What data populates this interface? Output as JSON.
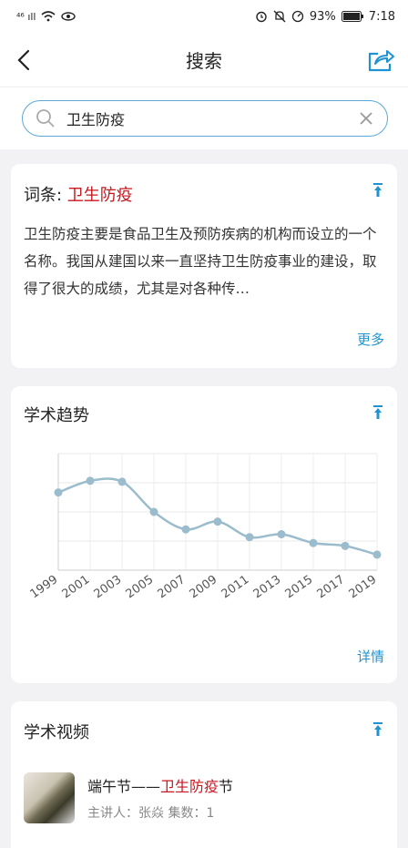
{
  "status": {
    "network": "⁴⁶ ıll",
    "battery": "93%",
    "time": "7:18"
  },
  "header": {
    "title": "搜索"
  },
  "search": {
    "query": "卫生防疫"
  },
  "entry": {
    "label": "词条: ",
    "term": "卫生防疫",
    "description": "卫生防疫主要是食品卫生及预防疾病的机构而设立的一个名称。我国从建国以来一直坚持卫生防疫事业的建设，取得了很大的成绩，尤其是对各种传…",
    "more": "更多"
  },
  "trend": {
    "title": "学术趋势",
    "details": "详情"
  },
  "chart_data": {
    "type": "line",
    "x": [
      "1999",
      "2001",
      "2003",
      "2005",
      "2007",
      "2009",
      "2011",
      "2013",
      "2015",
      "2017",
      "2019"
    ],
    "values": [
      80,
      92,
      91,
      60,
      42,
      50,
      34,
      37,
      28,
      25,
      16
    ],
    "ylim": [
      0,
      120
    ],
    "grid": true,
    "color": "#9bbccd"
  },
  "videos": {
    "title": "学术视频",
    "items": [
      {
        "title_prefix": "端午节——",
        "title_highlight": "卫生防疫",
        "title_suffix": "节",
        "meta": "主讲人：张焱  集数：1"
      }
    ]
  }
}
